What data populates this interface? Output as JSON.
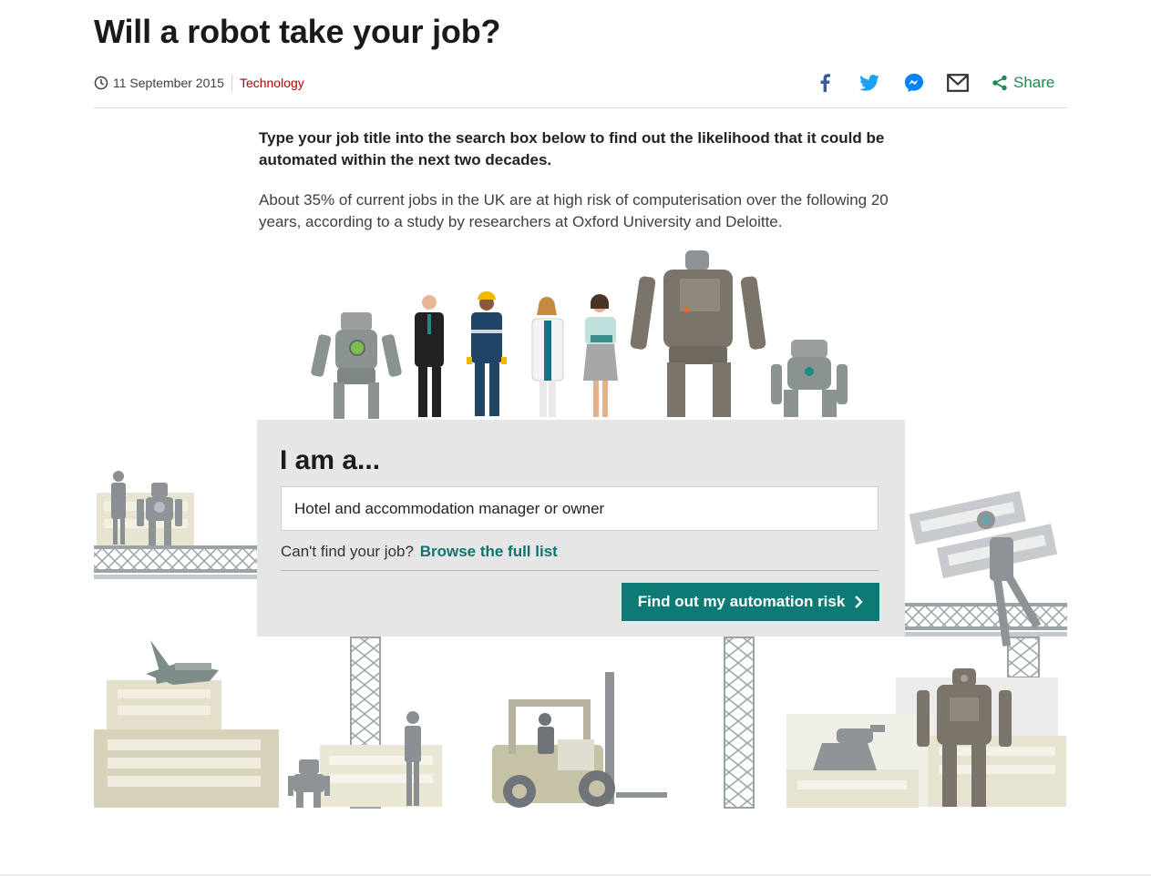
{
  "article": {
    "title": "Will a robot take your job?",
    "date": "11 September 2015",
    "category": "Technology",
    "intro": "Type your job title into the search box below to find out the likelihood that it could be automated within the next two decades.",
    "body": "About 35% of current jobs in the UK are at high risk of computerisation over the following 20 years, according to a study by researchers at Oxford University and Deloitte."
  },
  "share": {
    "icons": [
      "facebook-icon",
      "twitter-icon",
      "messenger-icon",
      "email-icon",
      "share-icon"
    ],
    "label": "Share"
  },
  "search_panel": {
    "heading": "I am a...",
    "input_value": "Hotel and accommodation manager or owner",
    "cant_find_text": "Can't find your job?",
    "browse_link": "Browse the full list",
    "button_label": "Find out my automation risk"
  },
  "colors": {
    "accent_teal": "#0e7a75",
    "category_red": "#b80000",
    "share_green": "#1e8a4c",
    "panel_bg": "#e6e6e6",
    "facebook_blue": "#3b5998",
    "twitter_blue": "#1da1f2",
    "messenger_blue": "#0084ff"
  }
}
